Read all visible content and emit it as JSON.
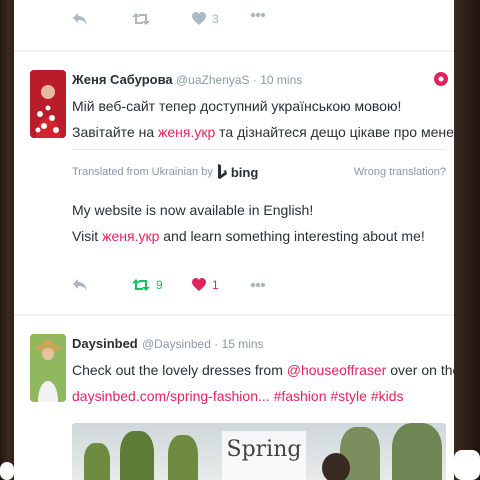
{
  "colors": {
    "accent": "#e0245e",
    "retweet_active": "#17bf63",
    "muted": "#aab8c2",
    "text": "#292f33"
  },
  "tweet_top": {
    "like_count": "3"
  },
  "tweet1": {
    "name": "Женя Сабурова",
    "handle": "@uaZhenyaS",
    "time": "· 10 mins",
    "line1": "Мій веб-сайт тепер доступний українською мовою!",
    "line2_pre": "Завітайте на",
    "line2_link": "женя.укр",
    "line2_post": "та дізнайтеся дещо цікаве про мене!",
    "translated_from": "Translated from Ukrainian by",
    "translator": "bing",
    "wrong_translation": "Wrong translation?",
    "trans1": "My website is now available in English!",
    "trans2_pre": "Visit",
    "trans2_link": "женя.укр",
    "trans2_post": "and learn something interesting about me!",
    "retweet_count": "9",
    "like_count": "1"
  },
  "tweet2": {
    "name": "Daysinbed",
    "handle": "@Daysinbed",
    "time": "· 15 mins",
    "line1_pre": "Check out the lovely dresses from",
    "line1_mention": "@houseoffraser",
    "line1_post": "over on the blog",
    "line2_link": "daysinbed.com/spring-fashion...",
    "hashtags": "#fashion #style #kids",
    "media_caption": "Spring"
  }
}
